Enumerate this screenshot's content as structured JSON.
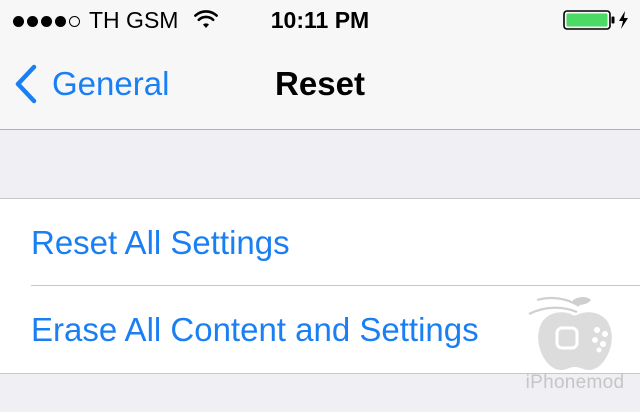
{
  "status_bar": {
    "carrier": "TH GSM",
    "time": "10:11 PM",
    "signal_bars": 4,
    "signal_total": 5,
    "battery_state": "charging",
    "icons": [
      "signal-dots-icon",
      "wifi-icon",
      "battery-icon",
      "charging-bolt-icon"
    ]
  },
  "nav": {
    "back_label": "General",
    "title": "Reset"
  },
  "rows": [
    {
      "label": "Reset All Settings"
    },
    {
      "label": "Erase All Content and Settings"
    }
  ],
  "watermark": {
    "text": "iPhonemod"
  },
  "colors": {
    "accent": "#1b7ff4",
    "background": "#efeff4",
    "battery_fill": "#4cd964"
  }
}
